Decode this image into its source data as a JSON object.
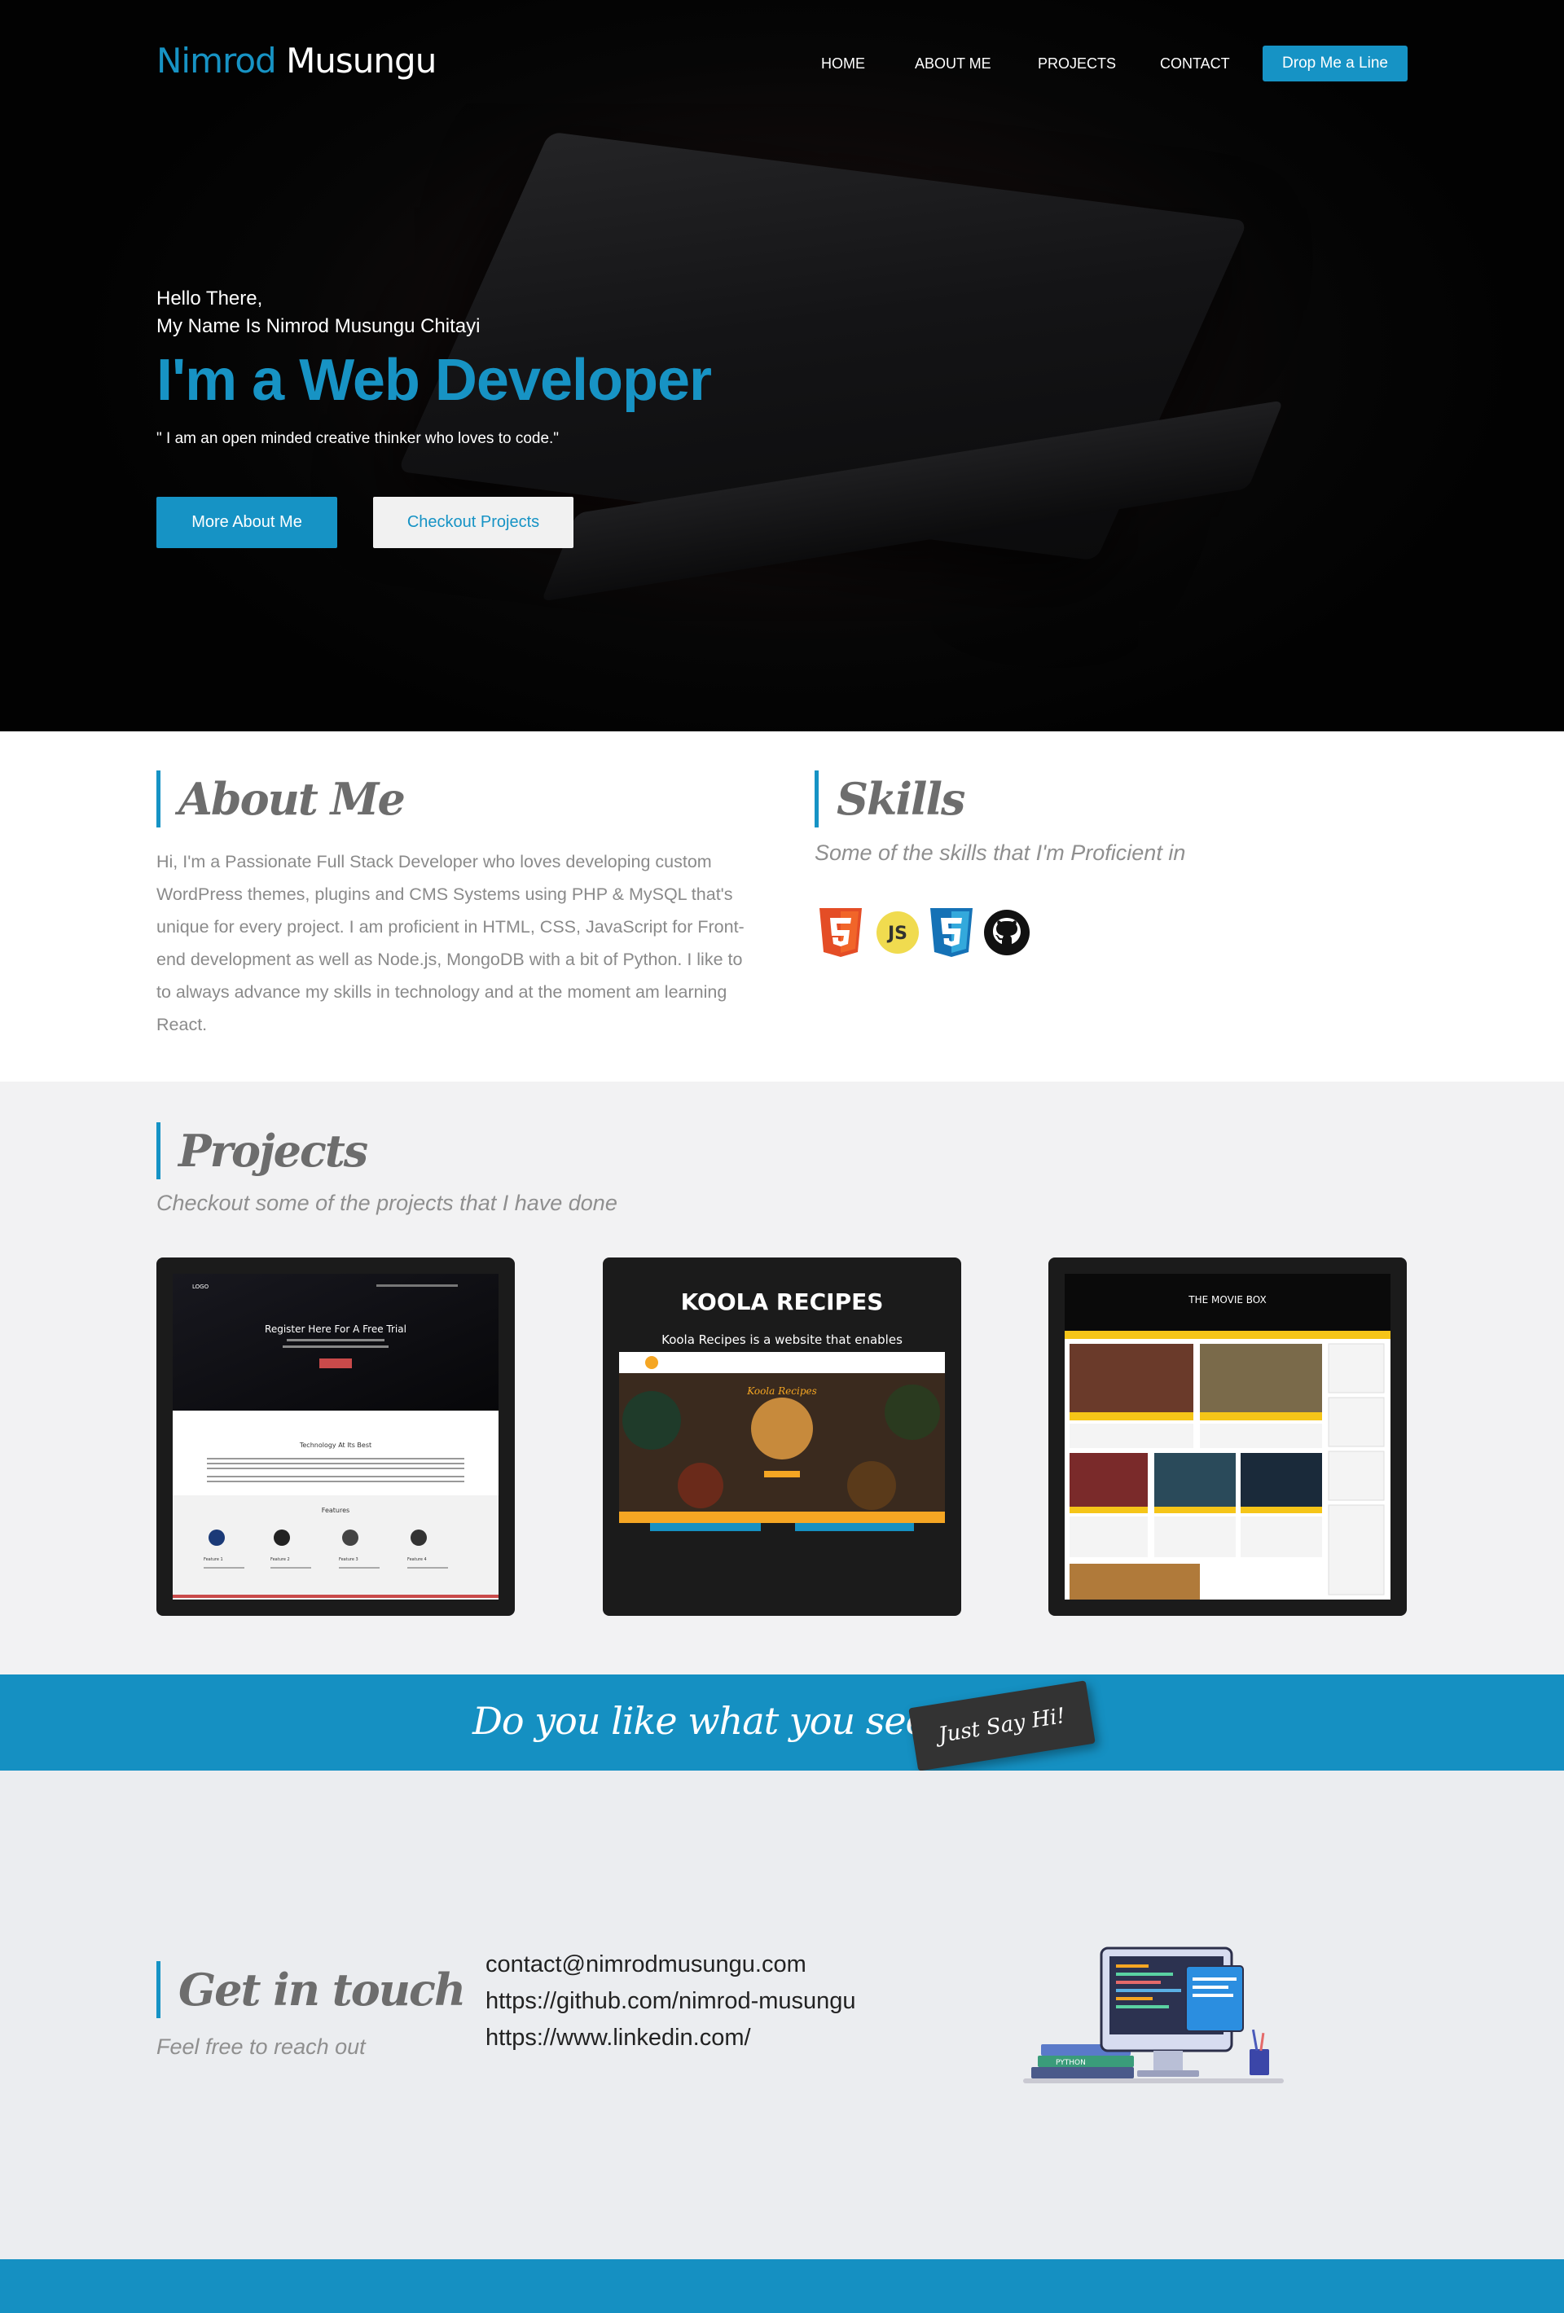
{
  "brand": {
    "first": "Nimrod",
    "last": "Musungu"
  },
  "nav": {
    "items": [
      "HOME",
      "ABOUT ME",
      "PROJECTS",
      "CONTACT"
    ],
    "cta": "Drop Me a Line"
  },
  "hero": {
    "greeting": "Hello There,",
    "name_line": "My Name Is Nimrod Musungu Chitayi",
    "role": "I'm a Web Developer",
    "quote": "\" I am an open minded creative thinker who loves to code.\"",
    "btn_about": "More About Me",
    "btn_projects": "Checkout Projects"
  },
  "about": {
    "title": "About Me",
    "text": "Hi, I'm a Passionate Full Stack Developer who loves developing custom WordPress themes, plugins and CMS Systems using PHP & MySQL that's unique for every project. I am proficient in HTML, CSS, JavaScript for Front-end development as well as Node.js, MongoDB with a bit of Python. I like to to always advance my skills in technology and at the moment am learning React."
  },
  "skills": {
    "title": "Skills",
    "subtitle": "Some of the skills that I'm Proficient in",
    "icons": [
      "html5-icon",
      "javascript-icon",
      "css3-icon",
      "github-icon"
    ],
    "js_label": "JS"
  },
  "projects": {
    "title": "Projects",
    "subtitle": "Checkout some of the projects that I have done",
    "p1": {
      "logo": "LOGO",
      "heading": "Register Here For A Free Trial",
      "section_title": "Technology At Its Best",
      "features_title": "Features",
      "features": [
        "Feature 1",
        "Feature 2",
        "Feature 3",
        "Feature 4"
      ]
    },
    "p2": {
      "title": "KOOLA RECIPES",
      "subtitle": "Koola Recipes is a website that enables",
      "banner_text": "Koola Recipes"
    },
    "p3": {
      "title": "THE MOVIE BOX"
    }
  },
  "banner": {
    "text": "Do you like what you see?",
    "button": "Just Say Hi!"
  },
  "contact": {
    "title": "Get in touch",
    "subtitle": "Feel free to reach out",
    "email": "contact@nimrodmusungu.com",
    "github": "https://github.com/nimrod-musungu",
    "linkedin": "https://www.linkedin.com/",
    "illustration_label": "PYTHON"
  },
  "colors": {
    "accent": "#1693c5",
    "dark": "#020202",
    "light_bg": "#ebedf0"
  }
}
